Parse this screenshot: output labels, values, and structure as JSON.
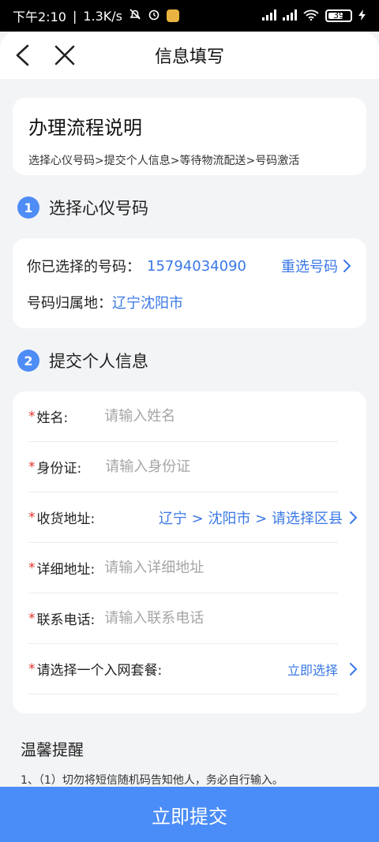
{
  "status": {
    "time": "下午2:10",
    "speed": "1.3K/s",
    "battery": "39"
  },
  "header": {
    "title": "信息填写"
  },
  "flow": {
    "title": "办理流程说明",
    "steps": "选择心仪号码>提交个人信息>等待物流配送>号码激活"
  },
  "section1": {
    "num": "1",
    "title": "选择心仪号码"
  },
  "number": {
    "label": "你已选择的号码：",
    "value": "15794034090",
    "reselect": "重选号码",
    "region_label": "号码归属地：",
    "region_value": "辽宁沈阳市"
  },
  "section2": {
    "num": "2",
    "title": "提交个人信息"
  },
  "form": {
    "required_mark": "*",
    "name_label": "姓名:",
    "name_placeholder": "请输入姓名",
    "id_label": "身份证:",
    "id_placeholder": "请输入身份证",
    "address_label": "收货地址:",
    "address_value": "辽宁 > 沈阳市 > 请选择区县",
    "detail_label": "详细地址:",
    "detail_placeholder": "请输入详细地址",
    "phone_label": "联系电话:",
    "phone_placeholder": "请输入联系电话",
    "plan_label": "请选择一个入网套餐:",
    "plan_value": "立即选择"
  },
  "tips": {
    "title": "温馨提醒",
    "line1": "1、（1）切勿将短信随机码告知他人，务必自行输入。"
  },
  "submit": {
    "label": "立即提交"
  },
  "colors": {
    "accent": "#4b8df8",
    "link": "#3a78e6",
    "required": "#e0312c"
  }
}
